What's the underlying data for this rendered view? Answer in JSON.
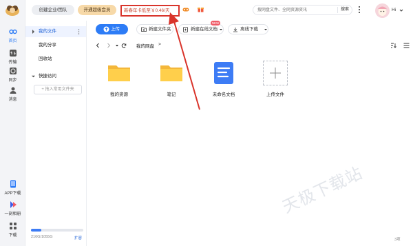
{
  "colors": {
    "accent": "#2d7cf6",
    "promo_border": "#d9342b",
    "vip_pill": "#f7d9a8",
    "rail_bg": "#f3f4f7"
  },
  "rail": {
    "items": [
      {
        "label": "首页",
        "icon": "cloud-home-icon"
      },
      {
        "label": "传输",
        "icon": "transfer-icon"
      },
      {
        "label": "同步",
        "icon": "sync-icon"
      },
      {
        "label": "消息",
        "icon": "message-icon"
      },
      {
        "label": "APP下载",
        "icon": "phone-icon"
      },
      {
        "label": "一刻相册",
        "icon": "album-icon"
      },
      {
        "label": "下载",
        "icon": "grid-apps-icon"
      }
    ]
  },
  "topbar": {
    "business_button": "创建企业/团队",
    "vip_button": "开通超级会员",
    "promo_text": "新春年卡低至￥0.46/天",
    "search_placeholder": "搜网盘文件、全网资源资讯",
    "search_button": "搜索",
    "greeting": "Hi"
  },
  "tree": {
    "my_files": "我的文件",
    "my_share": "我的分享",
    "recycle_bin": "回收站",
    "quick_access": "快捷访问",
    "add_quick": "+ 拖入常用文件夹",
    "storage_text": "216G/1055G",
    "storage_fraction": 0.2,
    "expand_label": "扩容"
  },
  "toolbar": {
    "upload": "上传",
    "new_folder": "新建文件夹",
    "new_online_doc": "新建在线文档",
    "new_badge": "NEW",
    "offline_download": "离线下载"
  },
  "address": {
    "crumb": "我的网盘",
    "sep": ">"
  },
  "files": [
    {
      "name": "我的资源",
      "icon": "folder-icon"
    },
    {
      "name": "笔记",
      "icon": "folder-icon"
    },
    {
      "name": "未命名文档",
      "icon": "doc-icon"
    },
    {
      "name": "上传文件",
      "icon": "plus-icon"
    }
  ],
  "watermark": "天极下载站",
  "count_text": "3项"
}
